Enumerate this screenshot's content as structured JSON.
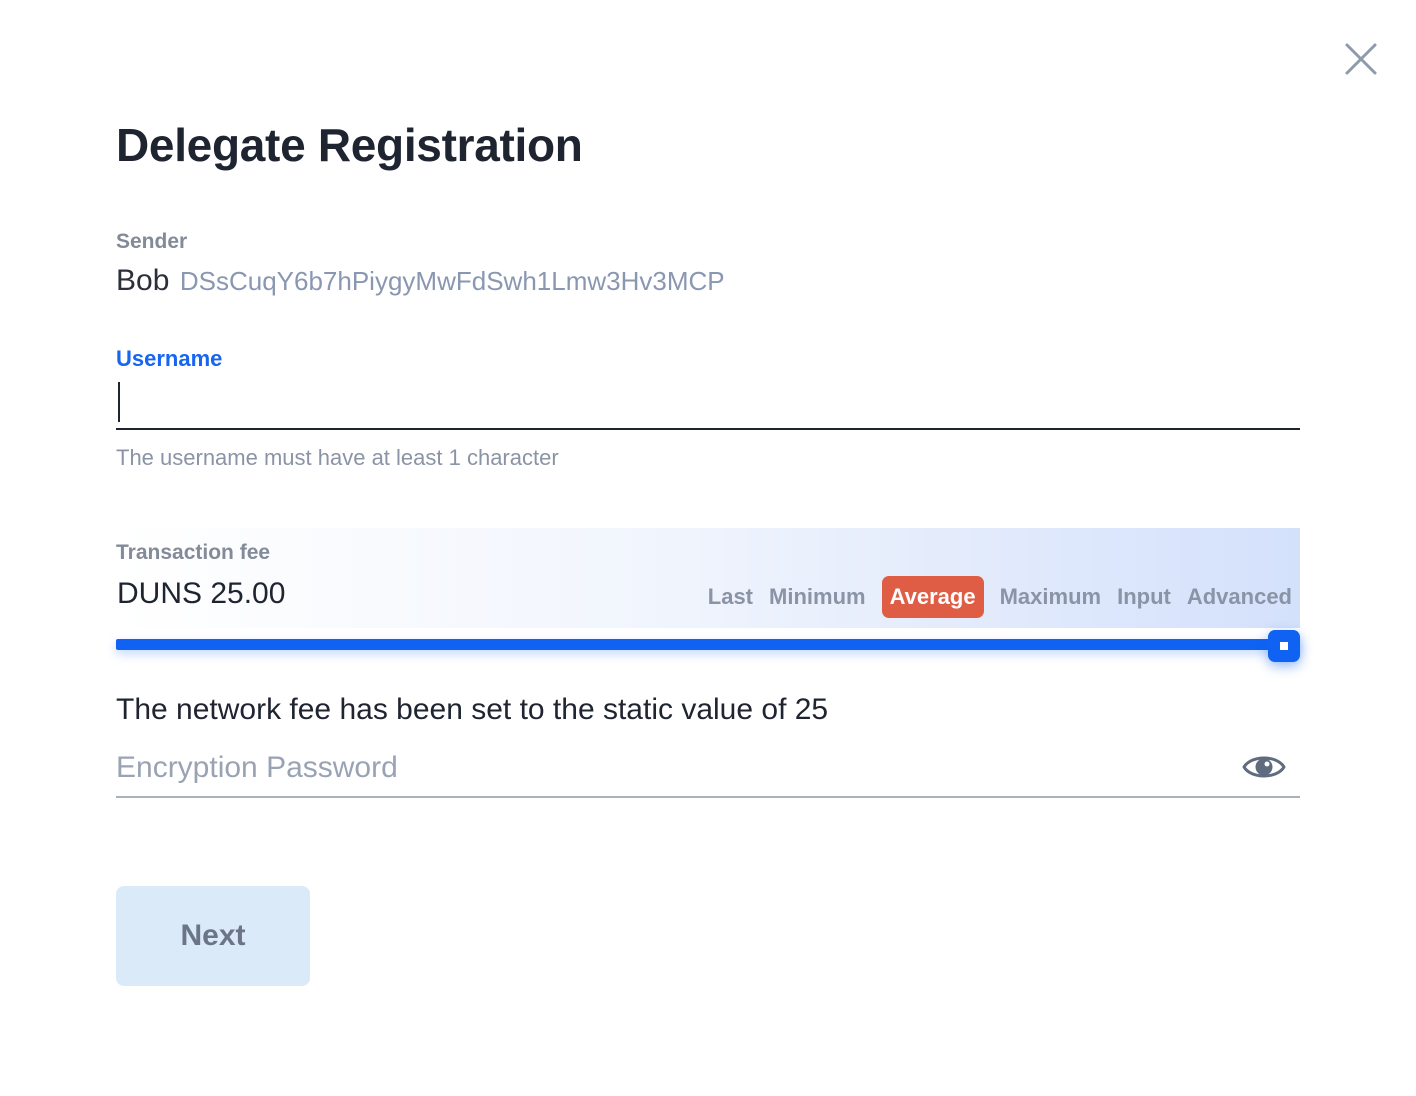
{
  "modal": {
    "title": "Delegate Registration",
    "close_icon": "close-icon"
  },
  "sender": {
    "label": "Sender",
    "name": "Bob",
    "address": "DSsCuqY6b7hPiygyMwFdSwh1Lmw3Hv3MCP"
  },
  "username": {
    "label": "Username",
    "value": "",
    "help": "The username must have at least 1 character"
  },
  "fee": {
    "label": "Transaction fee",
    "value": "DUNS 25.00",
    "options": [
      {
        "label": "Last",
        "active": false
      },
      {
        "label": "Minimum",
        "active": false
      },
      {
        "label": "Average",
        "active": true
      },
      {
        "label": "Maximum",
        "active": false
      },
      {
        "label": "Input",
        "active": false
      },
      {
        "label": "Advanced",
        "active": false
      }
    ],
    "slider_fraction": 1.0,
    "notice": "The network fee has been set to the static value of 25"
  },
  "password": {
    "placeholder": "Encryption Password",
    "toggle_icon": "eye-icon"
  },
  "actions": {
    "next_label": "Next"
  },
  "colors": {
    "accent": "#1062f2",
    "active_option": "#e05d45",
    "next_button_bg": "#dbeaf8"
  }
}
